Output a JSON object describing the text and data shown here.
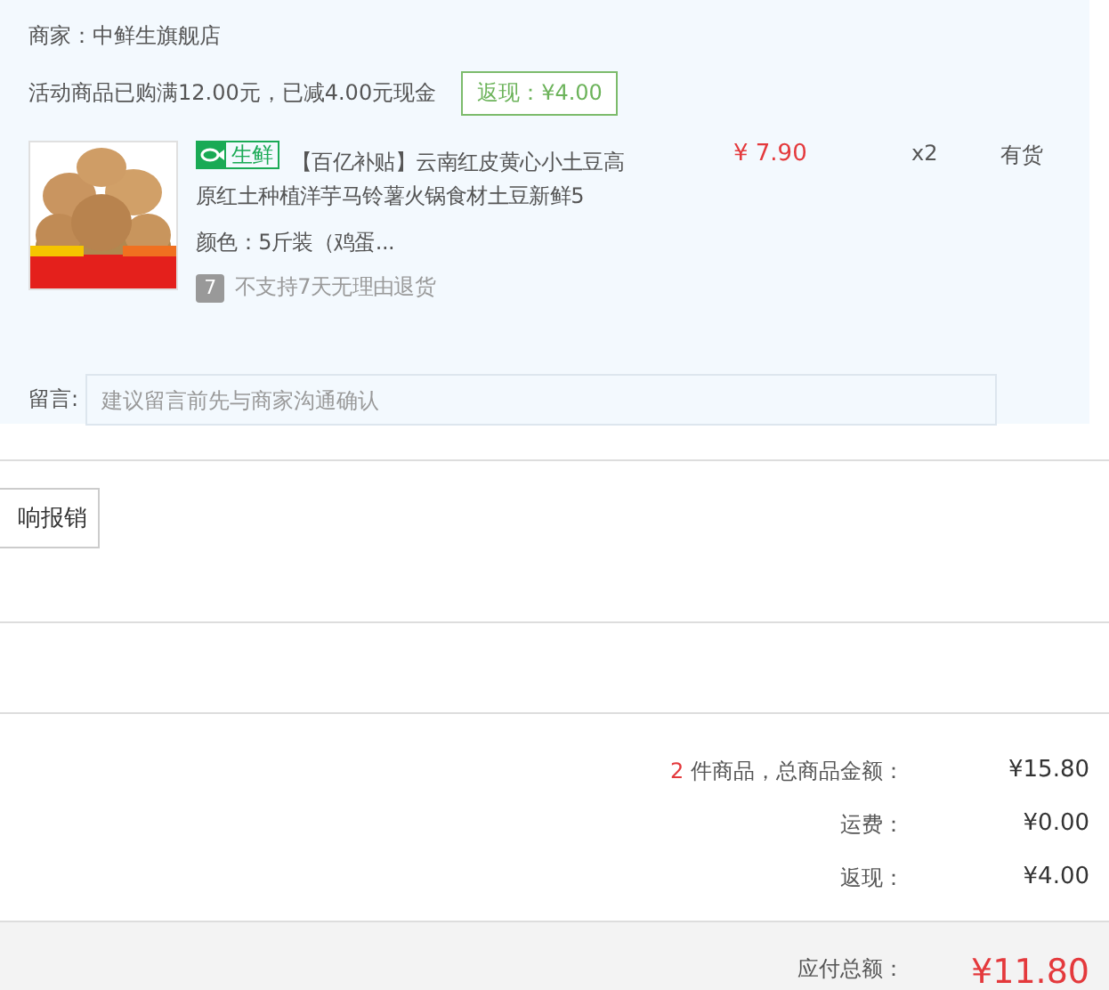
{
  "shop": {
    "merchant": "商家：中鲜生旗舰店",
    "promo": "活动商品已购满12.00元，已减4.00元现金",
    "cashback_badge": "返现：¥4.00"
  },
  "product": {
    "tag": "生鲜",
    "title": "【百亿补贴】云南红皮黄心小土豆高原红土种植洋芋马铃薯火锅食材土豆新鲜5",
    "variant": "颜色：5斤装（鸡蛋...",
    "return_badge": "7",
    "return_policy": "不支持7天无理由退货",
    "price": "¥ 7.90",
    "quantity": "x2",
    "stock": "有货"
  },
  "message": {
    "label": "留言:",
    "placeholder": "建议留言前先与商家沟通确认"
  },
  "partial_button": "响报销",
  "summary": {
    "rows": [
      {
        "count": "2",
        "label": " 件商品，总商品金额：",
        "value": "¥15.80"
      },
      {
        "label": "运费：",
        "value": "¥0.00"
      },
      {
        "label": "返现：",
        "value": "¥4.00"
      }
    ],
    "total_label": "应付总额：",
    "total_value": "¥11.80"
  }
}
